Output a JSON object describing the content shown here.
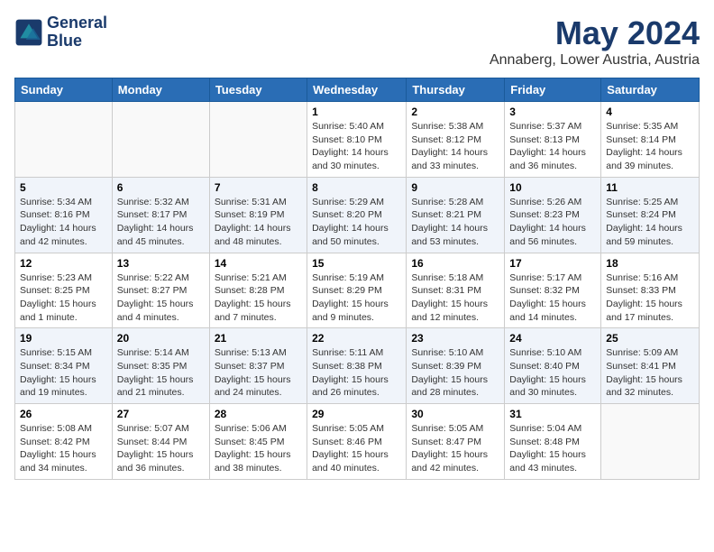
{
  "header": {
    "logo_line1": "General",
    "logo_line2": "Blue",
    "month": "May 2024",
    "location": "Annaberg, Lower Austria, Austria"
  },
  "weekdays": [
    "Sunday",
    "Monday",
    "Tuesday",
    "Wednesday",
    "Thursday",
    "Friday",
    "Saturday"
  ],
  "weeks": [
    [
      {
        "day": "",
        "info": ""
      },
      {
        "day": "",
        "info": ""
      },
      {
        "day": "",
        "info": ""
      },
      {
        "day": "1",
        "info": "Sunrise: 5:40 AM\nSunset: 8:10 PM\nDaylight: 14 hours\nand 30 minutes."
      },
      {
        "day": "2",
        "info": "Sunrise: 5:38 AM\nSunset: 8:12 PM\nDaylight: 14 hours\nand 33 minutes."
      },
      {
        "day": "3",
        "info": "Sunrise: 5:37 AM\nSunset: 8:13 PM\nDaylight: 14 hours\nand 36 minutes."
      },
      {
        "day": "4",
        "info": "Sunrise: 5:35 AM\nSunset: 8:14 PM\nDaylight: 14 hours\nand 39 minutes."
      }
    ],
    [
      {
        "day": "5",
        "info": "Sunrise: 5:34 AM\nSunset: 8:16 PM\nDaylight: 14 hours\nand 42 minutes."
      },
      {
        "day": "6",
        "info": "Sunrise: 5:32 AM\nSunset: 8:17 PM\nDaylight: 14 hours\nand 45 minutes."
      },
      {
        "day": "7",
        "info": "Sunrise: 5:31 AM\nSunset: 8:19 PM\nDaylight: 14 hours\nand 48 minutes."
      },
      {
        "day": "8",
        "info": "Sunrise: 5:29 AM\nSunset: 8:20 PM\nDaylight: 14 hours\nand 50 minutes."
      },
      {
        "day": "9",
        "info": "Sunrise: 5:28 AM\nSunset: 8:21 PM\nDaylight: 14 hours\nand 53 minutes."
      },
      {
        "day": "10",
        "info": "Sunrise: 5:26 AM\nSunset: 8:23 PM\nDaylight: 14 hours\nand 56 minutes."
      },
      {
        "day": "11",
        "info": "Sunrise: 5:25 AM\nSunset: 8:24 PM\nDaylight: 14 hours\nand 59 minutes."
      }
    ],
    [
      {
        "day": "12",
        "info": "Sunrise: 5:23 AM\nSunset: 8:25 PM\nDaylight: 15 hours\nand 1 minute."
      },
      {
        "day": "13",
        "info": "Sunrise: 5:22 AM\nSunset: 8:27 PM\nDaylight: 15 hours\nand 4 minutes."
      },
      {
        "day": "14",
        "info": "Sunrise: 5:21 AM\nSunset: 8:28 PM\nDaylight: 15 hours\nand 7 minutes."
      },
      {
        "day": "15",
        "info": "Sunrise: 5:19 AM\nSunset: 8:29 PM\nDaylight: 15 hours\nand 9 minutes."
      },
      {
        "day": "16",
        "info": "Sunrise: 5:18 AM\nSunset: 8:31 PM\nDaylight: 15 hours\nand 12 minutes."
      },
      {
        "day": "17",
        "info": "Sunrise: 5:17 AM\nSunset: 8:32 PM\nDaylight: 15 hours\nand 14 minutes."
      },
      {
        "day": "18",
        "info": "Sunrise: 5:16 AM\nSunset: 8:33 PM\nDaylight: 15 hours\nand 17 minutes."
      }
    ],
    [
      {
        "day": "19",
        "info": "Sunrise: 5:15 AM\nSunset: 8:34 PM\nDaylight: 15 hours\nand 19 minutes."
      },
      {
        "day": "20",
        "info": "Sunrise: 5:14 AM\nSunset: 8:35 PM\nDaylight: 15 hours\nand 21 minutes."
      },
      {
        "day": "21",
        "info": "Sunrise: 5:13 AM\nSunset: 8:37 PM\nDaylight: 15 hours\nand 24 minutes."
      },
      {
        "day": "22",
        "info": "Sunrise: 5:11 AM\nSunset: 8:38 PM\nDaylight: 15 hours\nand 26 minutes."
      },
      {
        "day": "23",
        "info": "Sunrise: 5:10 AM\nSunset: 8:39 PM\nDaylight: 15 hours\nand 28 minutes."
      },
      {
        "day": "24",
        "info": "Sunrise: 5:10 AM\nSunset: 8:40 PM\nDaylight: 15 hours\nand 30 minutes."
      },
      {
        "day": "25",
        "info": "Sunrise: 5:09 AM\nSunset: 8:41 PM\nDaylight: 15 hours\nand 32 minutes."
      }
    ],
    [
      {
        "day": "26",
        "info": "Sunrise: 5:08 AM\nSunset: 8:42 PM\nDaylight: 15 hours\nand 34 minutes."
      },
      {
        "day": "27",
        "info": "Sunrise: 5:07 AM\nSunset: 8:44 PM\nDaylight: 15 hours\nand 36 minutes."
      },
      {
        "day": "28",
        "info": "Sunrise: 5:06 AM\nSunset: 8:45 PM\nDaylight: 15 hours\nand 38 minutes."
      },
      {
        "day": "29",
        "info": "Sunrise: 5:05 AM\nSunset: 8:46 PM\nDaylight: 15 hours\nand 40 minutes."
      },
      {
        "day": "30",
        "info": "Sunrise: 5:05 AM\nSunset: 8:47 PM\nDaylight: 15 hours\nand 42 minutes."
      },
      {
        "day": "31",
        "info": "Sunrise: 5:04 AM\nSunset: 8:48 PM\nDaylight: 15 hours\nand 43 minutes."
      },
      {
        "day": "",
        "info": ""
      }
    ]
  ]
}
